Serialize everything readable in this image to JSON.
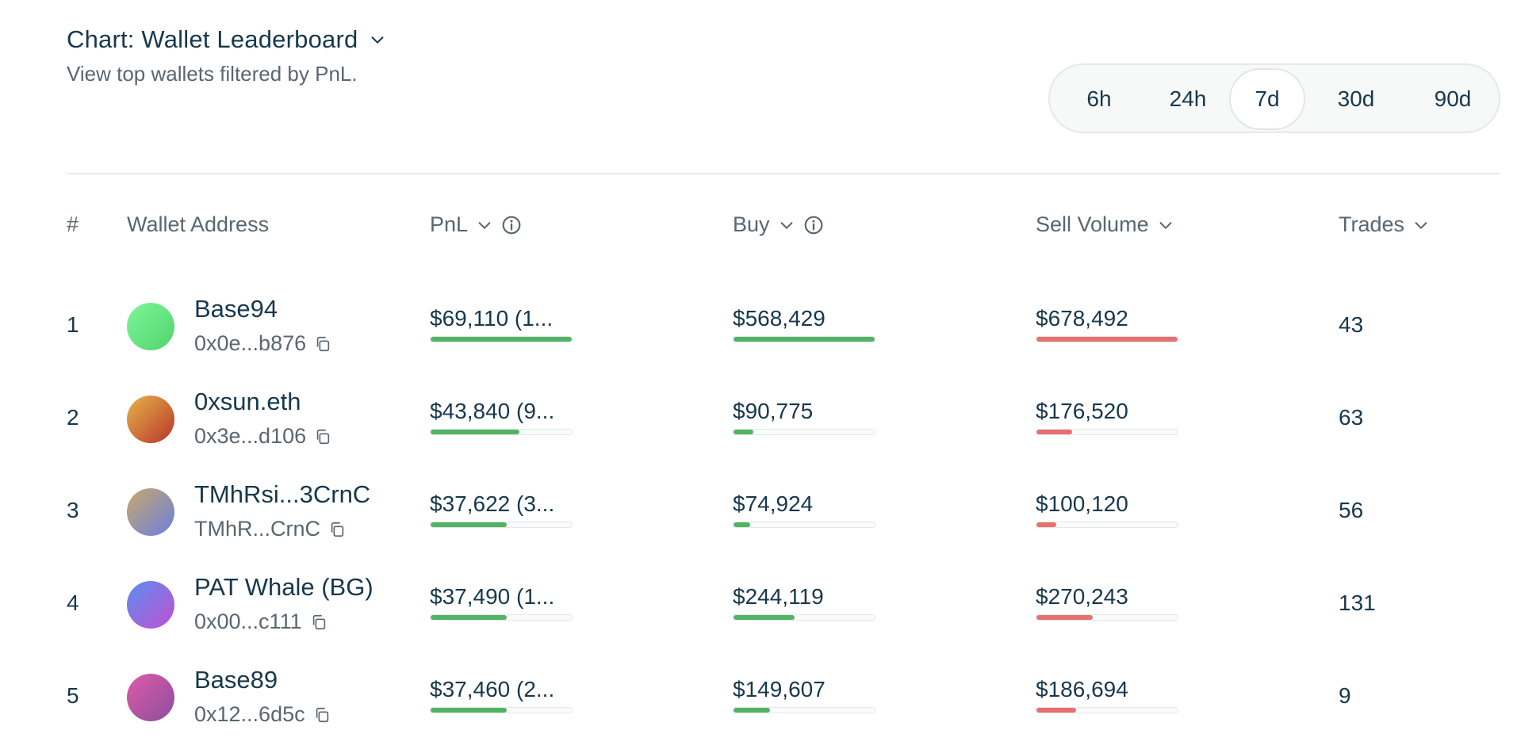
{
  "header": {
    "title": "Chart: Wallet Leaderboard",
    "subtitle": "View top wallets filtered by PnL."
  },
  "time_range": {
    "options": [
      "6h",
      "24h",
      "7d",
      "30d",
      "90d"
    ],
    "selected": "7d"
  },
  "table": {
    "columns": {
      "rank": "#",
      "wallet": "Wallet Address",
      "pnl": "PnL",
      "buy": "Buy",
      "sell": "Sell Volume",
      "trades": "Trades"
    },
    "rows": [
      {
        "rank": "1",
        "name": "Base94",
        "address": "0x0e...b876",
        "pnl": "$69,110 (1...",
        "buy": "$568,429",
        "sell": "$678,492",
        "trades": "43",
        "pnl_fill": 1.0,
        "buy_fill": 1.0,
        "sell_fill": 1.0,
        "avatar": [
          "#7df59a",
          "#52d46c"
        ]
      },
      {
        "rank": "2",
        "name": "0xsun.eth",
        "address": "0x3e...d106",
        "pnl": "$43,840 (9...",
        "buy": "$90,775",
        "sell": "$176,520",
        "trades": "63",
        "pnl_fill": 0.63,
        "buy_fill": 0.14,
        "sell_fill": 0.25,
        "avatar": [
          "#e8b54a",
          "#b5352a"
        ]
      },
      {
        "rank": "3",
        "name": "TMhRsi...3CrnC",
        "address": "TMhR...CrnC",
        "pnl": "$37,622 (3...",
        "buy": "$74,924",
        "sell": "$100,120",
        "trades": "56",
        "pnl_fill": 0.54,
        "buy_fill": 0.12,
        "sell_fill": 0.14,
        "avatar": [
          "#c9a86a",
          "#6a7fe0"
        ]
      },
      {
        "rank": "4",
        "name": "PAT Whale (BG)",
        "address": "0x00...c111",
        "pnl": "$37,490 (1...",
        "buy": "$244,119",
        "sell": "$270,243",
        "trades": "131",
        "pnl_fill": 0.54,
        "buy_fill": 0.43,
        "sell_fill": 0.4,
        "avatar": [
          "#5a8ff0",
          "#c24fd2"
        ]
      },
      {
        "rank": "5",
        "name": "Base89",
        "address": "0x12...6d5c",
        "pnl": "$37,460 (2...",
        "buy": "$149,607",
        "sell": "$186,694",
        "trades": "9",
        "pnl_fill": 0.54,
        "buy_fill": 0.26,
        "sell_fill": 0.28,
        "avatar": [
          "#e05aa8",
          "#8a4f9e"
        ]
      }
    ]
  },
  "colors": {
    "text": "#17384d",
    "muted": "#5a6670",
    "positive": "#52b463",
    "negative": "#e86f6f"
  },
  "icons": {
    "title_dropdown": "chevron-down-icon",
    "info": "info-icon",
    "sort": "chevron-down-icon",
    "copy": "copy-icon"
  }
}
